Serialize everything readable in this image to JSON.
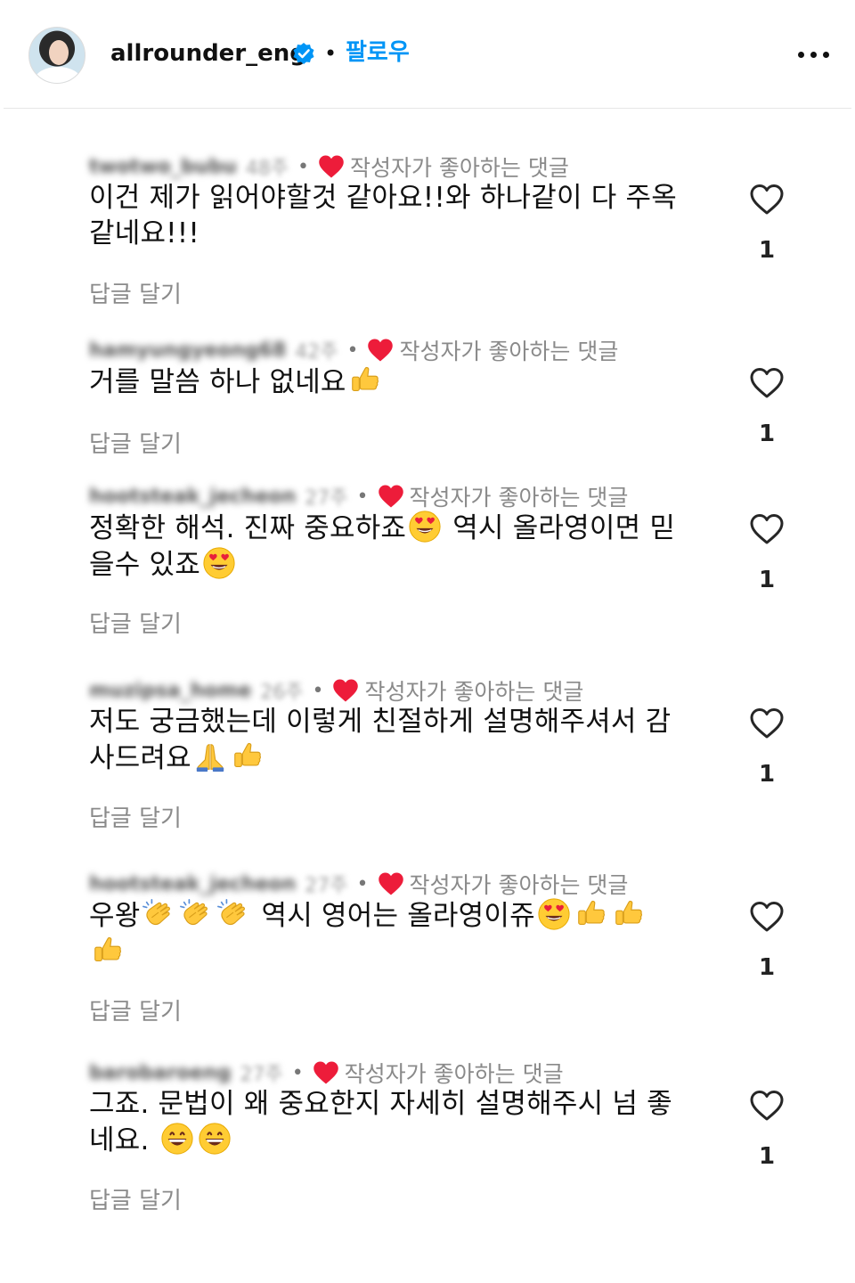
{
  "header": {
    "username": "allrounder_eng",
    "separator": "•",
    "follow_label": "팔로우"
  },
  "comments": [
    {
      "author": "twotwo_bubu",
      "time": "48주",
      "liked_label": "작성자가 좋아하는 댓글",
      "text_parts": [
        "이건 제가 읽어야할것 같아요!!와 하나같이 다 주옥",
        "같네요!!!"
      ],
      "reply_label": "답글 달기",
      "like_count": "1"
    },
    {
      "author": "hamyungyeong68",
      "time": "42주",
      "liked_label": "작성자가 좋아하는 댓글",
      "text_parts": [
        "거를 말씀 하나 없네요"
      ],
      "reply_label": "답글 달기",
      "like_count": "1"
    },
    {
      "author": "hootsteak_jecheon",
      "time": "27주",
      "liked_label": "작성자가 좋아하는 댓글",
      "text_parts": [
        "정확한 해석. 진짜 중요하죠",
        " 역시 올라영이면 믿",
        "을수 있죠"
      ],
      "reply_label": "답글 달기",
      "like_count": "1"
    },
    {
      "author": "muzipsa_home",
      "time": "26주",
      "liked_label": "작성자가 좋아하는 댓글",
      "text_parts": [
        "저도 궁금했는데 이렇게 친절하게 설명해주셔서 감",
        "사드려요"
      ],
      "reply_label": "답글 달기",
      "like_count": "1"
    },
    {
      "author": "hootsteak_jecheon",
      "time": "27주",
      "liked_label": "작성자가 좋아하는 댓글",
      "text_parts": [
        "우왕",
        " 역시 영어는 올라영이쥬"
      ],
      "reply_label": "답글 달기",
      "like_count": "1"
    },
    {
      "author": "barobaroeng",
      "time": "27주",
      "liked_label": "작성자가 좋아하는 댓글",
      "text_parts": [
        "그죠. 문법이 왜 중요한지 자세히 설명해주시 넘 좋",
        "네요. "
      ],
      "reply_label": "답글 달기",
      "like_count": "1"
    }
  ],
  "colors": {
    "accent": "#0095f6",
    "heart_red": "#ed1c3a",
    "muted": "#8a8a8a"
  },
  "icons": [
    "verified-badge-icon",
    "more-options-icon",
    "red-heart-icon",
    "heart-outline-icon",
    "heart-eyes-emoji",
    "thumbs-up-emoji",
    "clapping-hands-emoji",
    "folded-hands-emoji",
    "grinning-emoji"
  ]
}
